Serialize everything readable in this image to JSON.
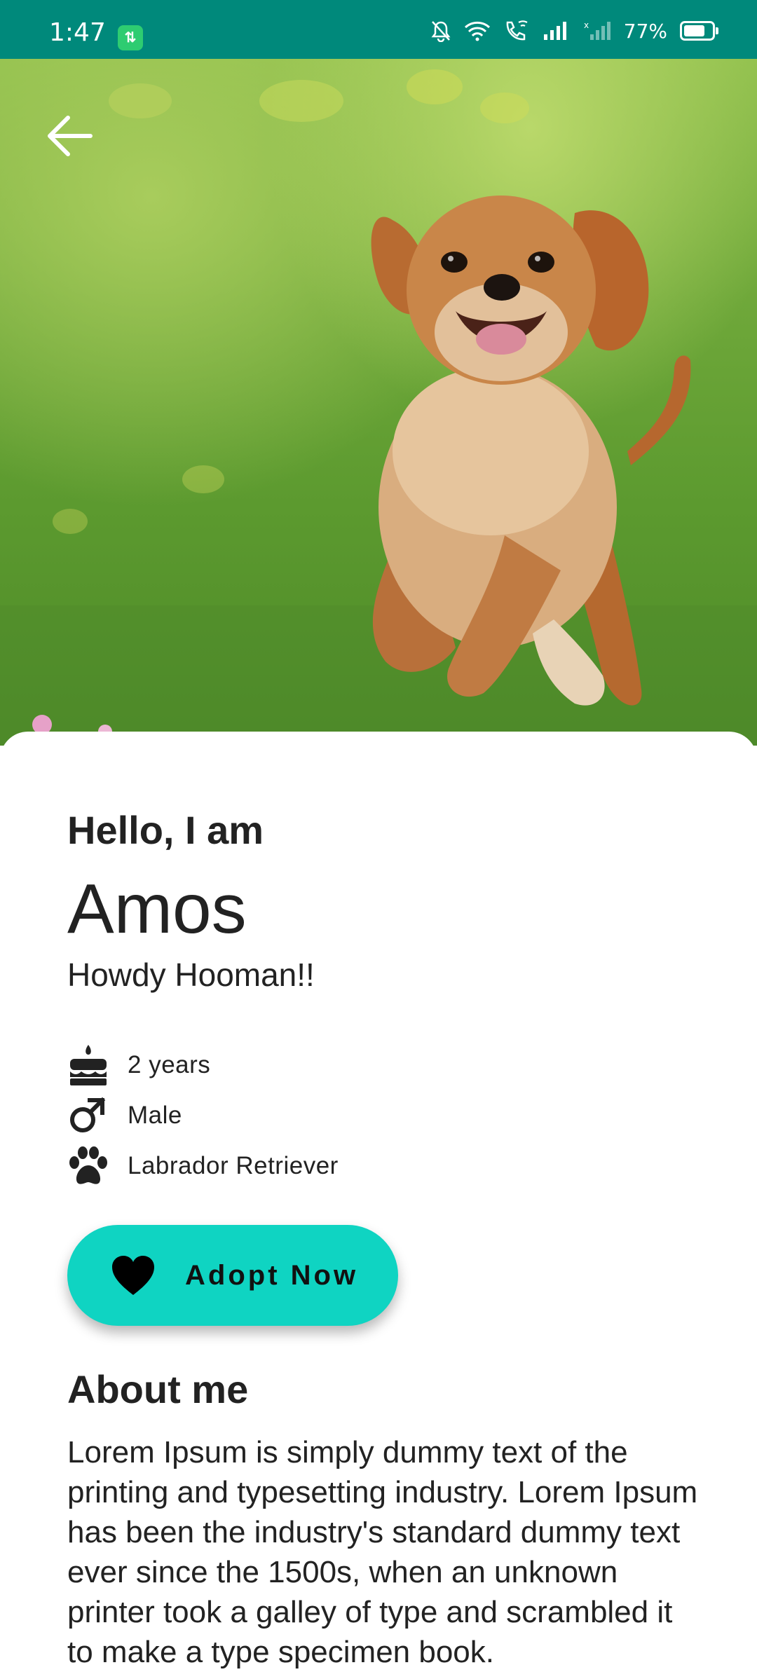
{
  "status_bar": {
    "time": "1:47",
    "app_chip": "⇅",
    "battery": "77%",
    "battery_level": 0.77,
    "icons": [
      "mute-bell-icon",
      "wifi-icon",
      "wifi-call-icon",
      "signal-icon",
      "signal-nodata-icon",
      "battery-icon"
    ]
  },
  "header": {
    "back_icon": "arrow-left-icon"
  },
  "pet": {
    "greeting": "Hello, I am",
    "name": "Amos",
    "tagline": "Howdy Hooman!!",
    "facts": [
      {
        "icon": "cake-icon",
        "text": "2 years"
      },
      {
        "icon": "male-icon",
        "text": "Male"
      },
      {
        "icon": "paw-icon",
        "text": "Labrador Retriever"
      }
    ]
  },
  "actions": {
    "adopt_label": "Adopt Now",
    "adopt_icon": "heart-icon"
  },
  "about": {
    "title": "About me",
    "body": "Lorem Ipsum is simply dummy text of the printing and typesetting industry. Lorem Ipsum has been the industry's standard dummy text ever since the 1500s, when an unknown printer took a galley of type and scrambled it to make a type specimen book."
  },
  "colors": {
    "status_bar": "#00897b",
    "accent": "#0fd4c2"
  }
}
